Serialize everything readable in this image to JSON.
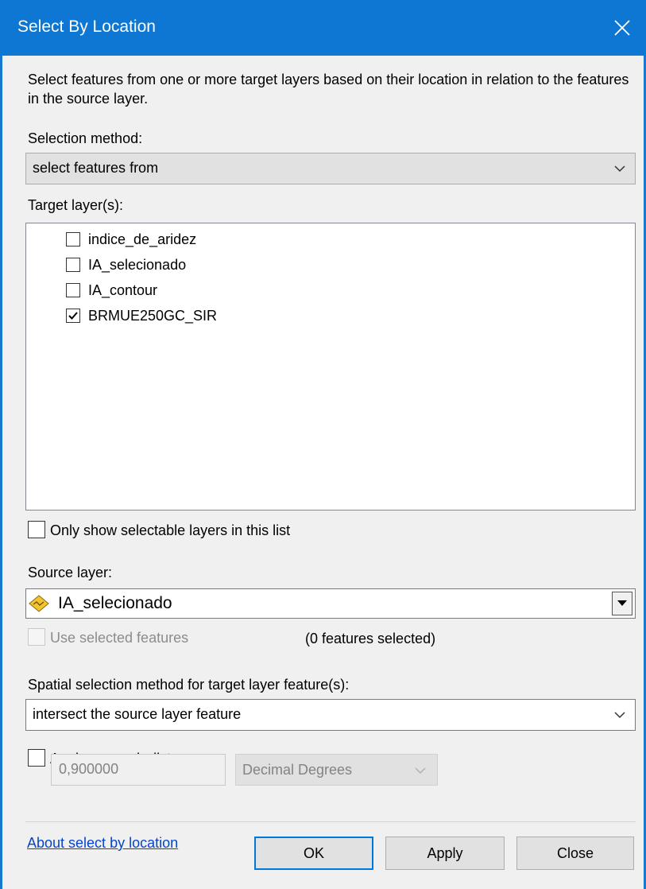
{
  "window": {
    "title": "Select By Location"
  },
  "description": "Select features from one or more target layers based on their location in relation to the features in the source layer.",
  "selection_method": {
    "label": "Selection method:",
    "value": "select features from"
  },
  "target_layers": {
    "label": "Target layer(s):",
    "items": [
      {
        "label": "indice_de_aridez",
        "checked": false
      },
      {
        "label": "IA_selecionado",
        "checked": false
      },
      {
        "label": "IA_contour",
        "checked": false
      },
      {
        "label": "BRMUE250GC_SIR",
        "checked": true
      }
    ]
  },
  "only_selectable": {
    "label": "Only show selectable layers in this list",
    "checked": false
  },
  "source_layer": {
    "label": "Source layer:",
    "value": "IA_selecionado",
    "icon": "polygon-layer-icon"
  },
  "use_selected": {
    "label": "Use selected features",
    "checked": false,
    "enabled": false,
    "count_text": "(0 features selected)"
  },
  "spatial_method": {
    "label": "Spatial selection method for target layer feature(s):",
    "value": "intersect the source layer feature"
  },
  "search_distance": {
    "label": "Apply a search distance",
    "checked": false,
    "value": "0,900000",
    "units": "Decimal Degrees"
  },
  "footer": {
    "link": "About select by location",
    "ok": "OK",
    "apply": "Apply",
    "close": "Close"
  }
}
